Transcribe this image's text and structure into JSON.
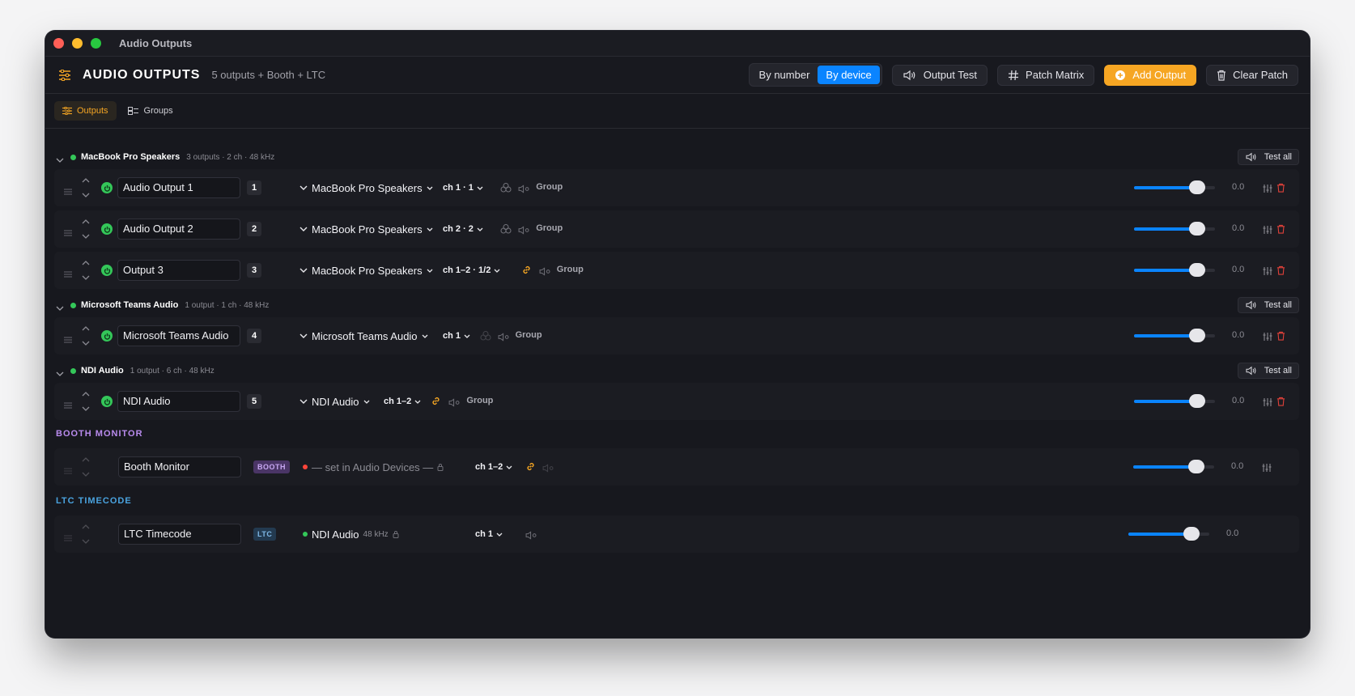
{
  "window": {
    "title": "Audio Outputs"
  },
  "header": {
    "title": "AUDIO OUTPUTS",
    "subtitle": "5 outputs + Booth + LTC",
    "view_toggle": [
      "By number",
      "By device"
    ],
    "view_selected": "By device",
    "output_test_label": "Output Test",
    "patch_matrix_label": "Patch Matrix",
    "add_output_label": "Add Output",
    "clear_patch_label": "Clear Patch"
  },
  "tabs": [
    {
      "label": "Outputs",
      "active": true
    },
    {
      "label": "Groups",
      "active": false
    }
  ],
  "groups": [
    {
      "name": "MacBook Pro Speakers",
      "meta": "3 outputs · 2 ch · 48 kHz",
      "test_all": "Test all",
      "rows": [
        {
          "name": "Audio Output 1",
          "number": "1",
          "device": "MacBook Pro Speakers",
          "channel": "ch 1 · 1",
          "group": "Group",
          "db": "0.0",
          "level": 0.78
        },
        {
          "name": "Audio Output 2",
          "number": "2",
          "device": "MacBook Pro Speakers",
          "channel": "ch 2 · 2",
          "group": "Group",
          "db": "0.0",
          "level": 0.78
        },
        {
          "name": "Output 3",
          "number": "3",
          "device": "MacBook Pro Speakers",
          "channel": "ch 1–2 · 1/2",
          "group": "Group",
          "db": "0.0",
          "level": 0.78
        }
      ]
    },
    {
      "name": "Microsoft Teams Audio",
      "meta": "1 output · 1 ch · 48 kHz",
      "test_all": "Test all",
      "rows": [
        {
          "name": "Microsoft Teams Audio",
          "number": "4",
          "device": "Microsoft Teams Audio",
          "channel": "ch 1",
          "group": "Group",
          "db": "0.0",
          "level": 0.78
        }
      ]
    },
    {
      "name": "NDI Audio",
      "meta": "1 output · 6 ch · 48 kHz",
      "test_all": "Test all",
      "rows": [
        {
          "name": "NDI Audio",
          "number": "5",
          "device": "NDI Audio",
          "channel": "ch 1–2",
          "group": "Group",
          "db": "0.0",
          "level": 0.78
        }
      ]
    }
  ],
  "booth": {
    "section_label": "BOOTH MONITOR",
    "name": "Booth Monitor",
    "tag": "BOOTH",
    "device_text": "— set in Audio Devices —",
    "channel": "ch 1–2",
    "db": "0.0",
    "level": 0.78,
    "status_color": "#ff453a"
  },
  "ltc": {
    "section_label": "LTC TIMECODE",
    "name": "LTC Timecode",
    "tag": "LTC",
    "device": "NDI Audio",
    "rate": "48 kHz",
    "channel": "ch 1",
    "db": "0.0",
    "level": 0.78,
    "status_color": "#34c759"
  },
  "colors": {
    "accent_blue": "#0a84ff",
    "accent_orange": "#f6a623",
    "status_green": "#34c759",
    "danger_red": "#ff453a"
  }
}
